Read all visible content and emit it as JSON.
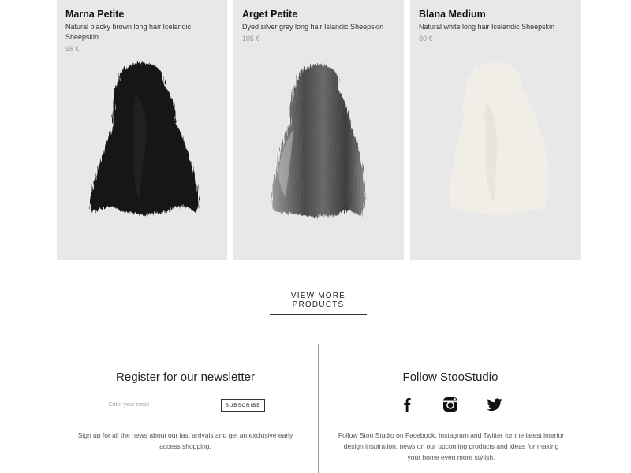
{
  "products": [
    {
      "name": "Marna Petite",
      "description": "Natural blacky brown long hair Icelandic Sheepskin",
      "price": "95 €",
      "image": "sheepskin-black",
      "color": "#141414"
    },
    {
      "name": "Arget Petite",
      "description": "Dyed silver grey long hair Islandic Sheepskin",
      "price": "105 €",
      "image": "sheepskin-grey",
      "color": "#555555"
    },
    {
      "name": "Blana Medium",
      "description": "Natural white long hair Icelandic Sheepskin",
      "price": "80 €",
      "image": "sheepskin-white",
      "color": "#f1eee8"
    }
  ],
  "view_more": "VIEW MORE PRODUCTS",
  "newsletter": {
    "title": "Register for our newsletter",
    "placeholder": "Enter your email",
    "button": "SUBSCRIBE",
    "text": "Sign up for all the news about our last arrivals and get an exclusive early access shopping."
  },
  "follow": {
    "title": "Follow StooStudio",
    "icons": [
      "facebook-icon",
      "instagram-icon",
      "twitter-icon"
    ],
    "text": "Follow Stoo Studio on Facebook, Instagram and Twitter for the latest interior design inspiration, news on our upcoming products and ideas for making your home even more stylish."
  }
}
